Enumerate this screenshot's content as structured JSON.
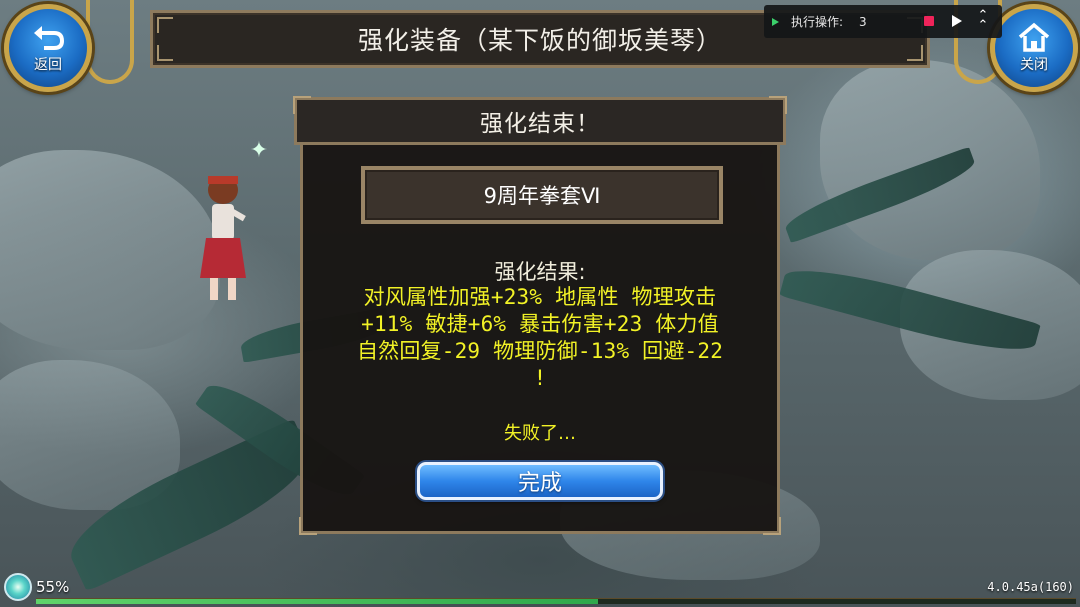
{
  "header": {
    "title": "强化装备（某下饭的御坂美琴）",
    "back_label": "返回",
    "close_label": "关闭"
  },
  "macro_bar": {
    "label": "执行操作:",
    "count": "3"
  },
  "dialog": {
    "title": "强化结束！",
    "item_name": "9周年拳套Ⅵ",
    "result_label": "强化结果:",
    "result_lines": [
      "对风属性加强+23% 地属性 物理攻击",
      "+11% 敏捷+6% 暴击伤害+23 体力值",
      "自然回复-29 物理防御-13% 回避-22",
      "!"
    ],
    "fail_text": "失败了…",
    "done_label": "完成"
  },
  "status": {
    "battery_percent": "55%",
    "version": "4.0.45a(160)",
    "progress_fraction": 0.54
  },
  "colors": {
    "result_text": "#f2f226",
    "panel_border": "#8d7a5d",
    "button_blue": "#2f86ea"
  }
}
